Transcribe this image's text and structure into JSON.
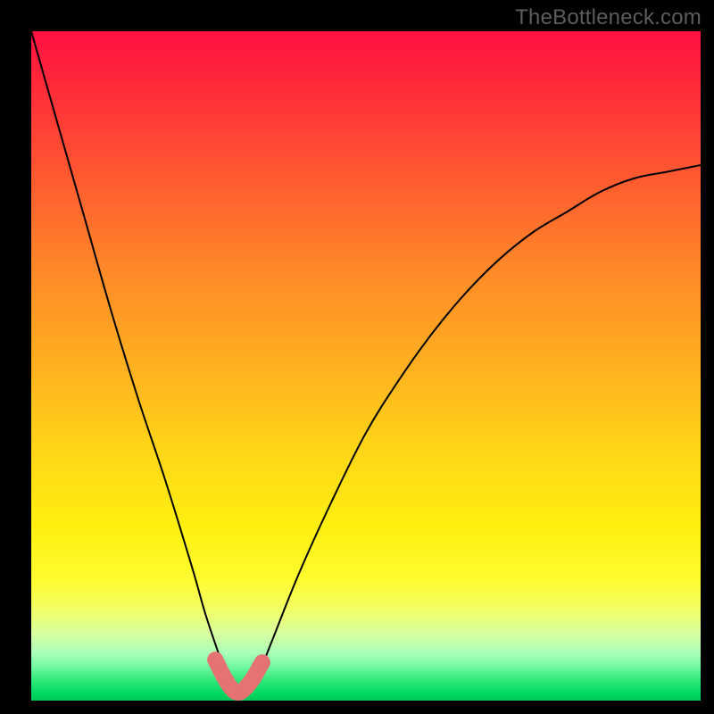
{
  "watermark": "TheBottleneck.com",
  "chart_data": {
    "type": "line",
    "title": "",
    "xlabel": "",
    "ylabel": "",
    "xlim": [
      0,
      100
    ],
    "ylim": [
      0,
      100
    ],
    "grid": false,
    "legend": false,
    "series": [
      {
        "name": "bottleneck-curve",
        "stroke": "#000000",
        "stroke_width": 2,
        "x": [
          0,
          4,
          8,
          12,
          16,
          20,
          24,
          26,
          28,
          29,
          30,
          31,
          32,
          33,
          34,
          36,
          40,
          45,
          50,
          55,
          60,
          65,
          70,
          75,
          80,
          85,
          90,
          95,
          100
        ],
        "values": [
          100,
          86,
          72,
          58,
          45,
          33,
          20,
          13,
          7,
          4,
          2,
          1,
          1,
          2,
          4,
          9,
          19,
          30,
          40,
          48,
          55,
          61,
          66,
          70,
          73,
          76,
          78,
          79,
          80
        ]
      },
      {
        "name": "marker-region",
        "type": "scatter",
        "color": "#e57373",
        "radius": 9,
        "x": [
          27.5,
          28.7,
          29.7,
          30.5,
          31.3,
          32.2,
          33.2,
          34.5
        ],
        "values": [
          6.1,
          3.7,
          2.1,
          1.3,
          1.3,
          2.1,
          3.4,
          5.7
        ]
      }
    ],
    "colors": {
      "gradient_top": "#ff1040",
      "gradient_mid": "#ffe818",
      "gradient_bottom": "#00c858",
      "curve": "#000000",
      "markers": "#e57373",
      "frame": "#000000"
    }
  }
}
